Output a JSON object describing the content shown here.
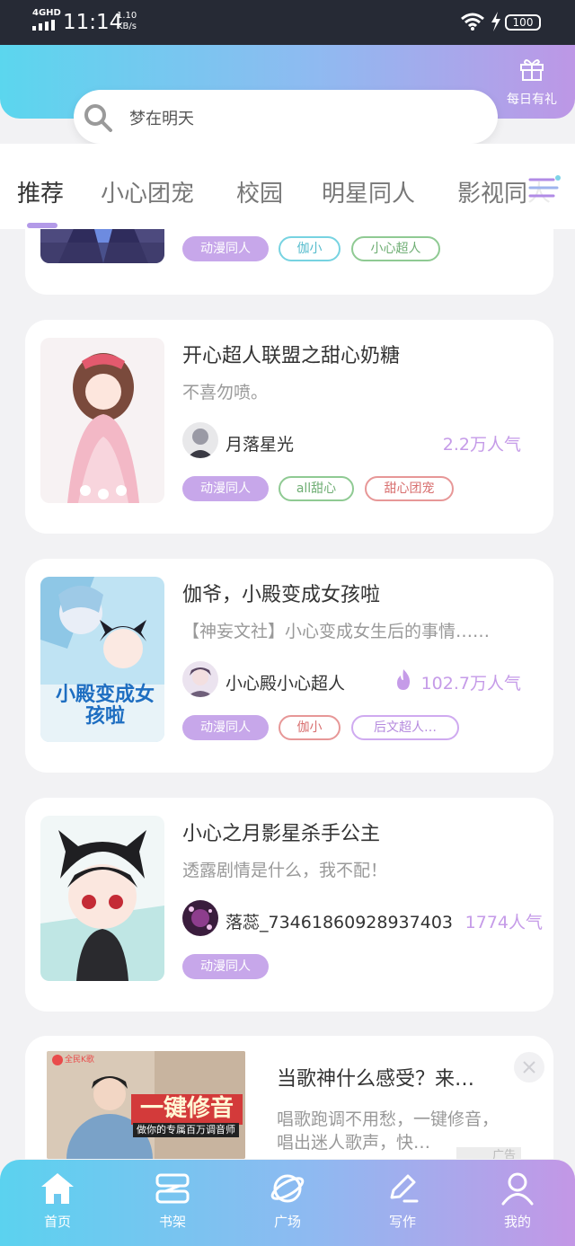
{
  "status_bar": {
    "network": "4GHD",
    "time": "11:14",
    "speed_value": "1.10",
    "speed_unit": "KB/s",
    "battery": "100"
  },
  "header": {
    "gift_label": "每日有礼",
    "search_placeholder": "梦在明天"
  },
  "tabs": [
    {
      "label": "推荐",
      "active": true
    },
    {
      "label": "小心团宠"
    },
    {
      "label": "校园"
    },
    {
      "label": "明星同人"
    },
    {
      "label": "影视同人"
    }
  ],
  "cards": [
    {
      "tags": [
        "动漫同人",
        "伽小",
        "小心超人"
      ]
    },
    {
      "title": "开心超人联盟之甜心奶糖",
      "desc": "不喜勿喷。",
      "author": "月落星光",
      "popularity": "2.2万人气",
      "tags": [
        "动漫同人",
        "all甜心",
        "甜心团宠"
      ]
    },
    {
      "title": "伽爷，小殿变成女孩啦",
      "desc": "【神妄文社】小心变成女生后的事情……",
      "author": "小心殿小心超人",
      "popularity": "102.7万人气",
      "tags": [
        "动漫同人",
        "伽小",
        "后文超人…"
      ],
      "cover_text": "小殿变成女孩啦"
    },
    {
      "title": "小心之月影星杀手公主",
      "desc": "透露剧情是什么，我不配！",
      "author": "落蕊_73461860928937403",
      "popularity": "1774人气",
      "tags": [
        "动漫同人"
      ]
    }
  ],
  "ad": {
    "title": "当歌神什么感受？来…",
    "desc": "唱歌跑调不用愁，一键修音，唱出迷人歌声，快…",
    "badge": "广告",
    "image_headline": "一键修音",
    "image_subline": "做你的专属百万调音师",
    "image_brand": "全民K歌"
  },
  "bottom_nav": [
    {
      "label": "首页",
      "icon": "home-icon",
      "active": true
    },
    {
      "label": "书架",
      "icon": "bookshelf-icon"
    },
    {
      "label": "广场",
      "icon": "planet-icon"
    },
    {
      "label": "写作",
      "icon": "pen-icon"
    },
    {
      "label": "我的",
      "icon": "user-icon"
    }
  ],
  "colors": {
    "accent_purple": "#c7a7ea",
    "popularity": "#c59be8",
    "header_start": "#5bd6ee",
    "header_end": "#bd97e6"
  }
}
